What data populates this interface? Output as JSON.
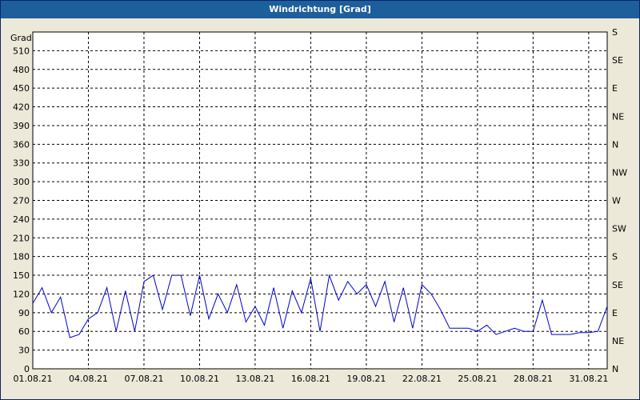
{
  "window": {
    "title": "Windrichtung [Grad]"
  },
  "chart_data": {
    "type": "line",
    "title": "Windrichtung [Grad]",
    "ylabel": "Grad",
    "ylim": [
      0,
      540
    ],
    "xlim": [
      "01.08.21",
      "01.09.21"
    ],
    "y_ticks": [
      0,
      30,
      60,
      90,
      120,
      150,
      180,
      210,
      240,
      270,
      300,
      330,
      360,
      390,
      420,
      450,
      480,
      510
    ],
    "x_ticks": [
      "01.08.21",
      "04.08.21",
      "07.08.21",
      "10.08.21",
      "13.08.21",
      "16.08.21",
      "19.08.21",
      "22.08.21",
      "25.08.21",
      "28.08.21",
      "31.08.21"
    ],
    "right_axis": [
      "N",
      "NE",
      "E",
      "SE",
      "S",
      "SW",
      "W",
      "NW",
      "N",
      "NE",
      "E",
      "SE",
      "S"
    ],
    "grid": true,
    "line_color": "#0000cc",
    "series": [
      {
        "x": [
          "01.08.21",
          "01.08.21 12:00",
          "02.08.21",
          "02.08.21 12:00",
          "03.08.21",
          "03.08.21 12:00",
          "04.08.21",
          "04.08.21 12:00",
          "05.08.21",
          "05.08.21 12:00",
          "06.08.21",
          "06.08.21 12:00",
          "07.08.21",
          "07.08.21 12:00",
          "08.08.21",
          "08.08.21 12:00",
          "09.08.21",
          "09.08.21 12:00",
          "10.08.21",
          "10.08.21 12:00",
          "11.08.21",
          "11.08.21 12:00",
          "12.08.21",
          "12.08.21 12:00",
          "13.08.21",
          "13.08.21 12:00",
          "14.08.21",
          "14.08.21 12:00",
          "15.08.21",
          "15.08.21 12:00",
          "16.08.21",
          "16.08.21 12:00",
          "17.08.21",
          "17.08.21 12:00",
          "18.08.21",
          "18.08.21 12:00",
          "19.08.21",
          "19.08.21 12:00",
          "20.08.21",
          "20.08.21 12:00",
          "21.08.21",
          "21.08.21 12:00",
          "22.08.21",
          "22.08.21 12:00",
          "23.08.21",
          "23.08.21 12:00",
          "24.08.21",
          "24.08.21 12:00",
          "25.08.21",
          "25.08.21 12:00",
          "26.08.21",
          "26.08.21 12:00",
          "27.08.21",
          "27.08.21 12:00",
          "28.08.21",
          "28.08.21 12:00",
          "29.08.21",
          "29.08.21 12:00",
          "30.08.21",
          "30.08.21 12:00",
          "31.08.21",
          "31.08.21 12:00",
          "01.09.21"
        ],
        "y": [
          105,
          130,
          90,
          115,
          50,
          55,
          80,
          90,
          130,
          60,
          125,
          60,
          140,
          150,
          95,
          150,
          150,
          85,
          150,
          80,
          120,
          90,
          135,
          75,
          100,
          70,
          130,
          65,
          125,
          90,
          145,
          60,
          150,
          110,
          140,
          120,
          135,
          100,
          140,
          75,
          130,
          65,
          135,
          120,
          95,
          65,
          65,
          65,
          60,
          70,
          55,
          60,
          65,
          60,
          60,
          110,
          55,
          55,
          55,
          58,
          58,
          60,
          100
        ]
      }
    ]
  }
}
